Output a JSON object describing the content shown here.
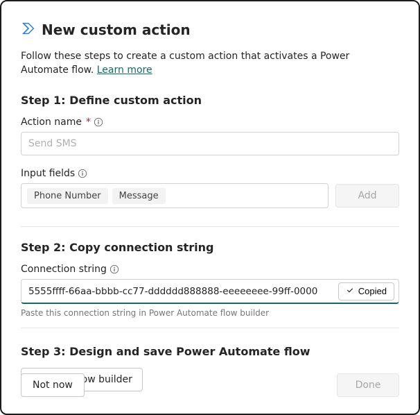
{
  "header": {
    "title": "New custom action"
  },
  "instruction": {
    "text": "Follow these steps to create a custom action that activates a Power Automate flow. ",
    "link": "Learn more"
  },
  "step1": {
    "title": "Step 1: Define custom action",
    "actionName": {
      "label": "Action name",
      "required": "*",
      "placeholder": "Send SMS"
    },
    "inputFields": {
      "label": "Input fields",
      "chips": [
        "Phone Number",
        "Message"
      ],
      "addLabel": "Add"
    }
  },
  "step2": {
    "title": "Step 2: Copy connection string",
    "label": "Connection string",
    "value": "5555ffff-66aa-bbbb-cc77-dddddd888888-eeeeeeee-99ff-0000",
    "copiedLabel": "Copied",
    "hint": "Paste this connection string in Power Automate flow builder"
  },
  "step3": {
    "title": "Step 3: Design and save Power Automate flow",
    "openLabel": "Open flow builder"
  },
  "footer": {
    "notNow": "Not now",
    "done": "Done"
  }
}
